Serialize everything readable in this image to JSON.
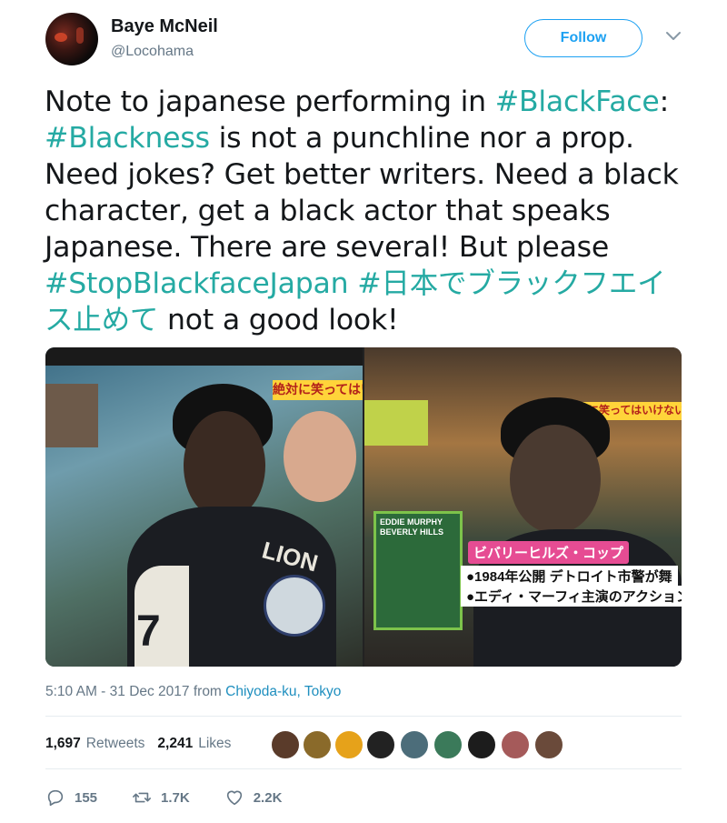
{
  "author": {
    "name": "Baye McNeil",
    "handle": "@Locohama"
  },
  "follow_label": "Follow",
  "tweet": {
    "lines": [
      [
        {
          "t": "Note to japanese performing in ",
          "tag": false
        },
        {
          "t": "#BlackFace",
          "tag": true
        },
        {
          "t": ":",
          "tag": false
        }
      ],
      [
        {
          "t": "#Blackness",
          "tag": true
        },
        {
          "t": " is not a punchline nor a prop.",
          "tag": false
        }
      ],
      [
        {
          "t": "Need jokes? Get better writers. Need a black",
          "tag": false
        }
      ],
      [
        {
          "t": "character, get a black actor that speaks",
          "tag": false
        }
      ],
      [
        {
          "t": "Japanese. There are several! But please",
          "tag": false
        }
      ],
      [
        {
          "t": "#StopBlackfaceJapan",
          "tag": true
        },
        {
          "t": " ",
          "tag": false
        },
        {
          "t": "#日本でブラックフエイ",
          "tag": true
        }
      ],
      [
        {
          "t": "ス止めて",
          "tag": true
        },
        {
          "t": " not a good look!",
          "tag": false
        }
      ]
    ]
  },
  "media": {
    "left_overlay": "絶対に笑ってはい",
    "right_overlay": "絶対に笑ってはいけない",
    "jersey_text": "LION",
    "jersey_number": "7",
    "poster_title": "EDDIE MURPHY BEVERLY HILLS",
    "caption_title": "ビバリーヒルズ・コップ",
    "caption_line1": "●1984年公開 デトロイト市警が舞",
    "caption_line2": "●エディ・マーフィ主演のアクション映"
  },
  "meta": {
    "time": "5:10 AM - 31 Dec 2017 from ",
    "place": "Chiyoda-ku, Tokyo"
  },
  "stats": {
    "retweets_count": "1,697",
    "retweets_label": "Retweets",
    "likes_count": "2,241",
    "likes_label": "Likes"
  },
  "actions": {
    "replies": "155",
    "retweets": "1.7K",
    "likes": "2.2K"
  },
  "colors": {
    "hashtag": "#25aaa3",
    "follow_blue": "#1da1f2",
    "muted": "#657786"
  }
}
